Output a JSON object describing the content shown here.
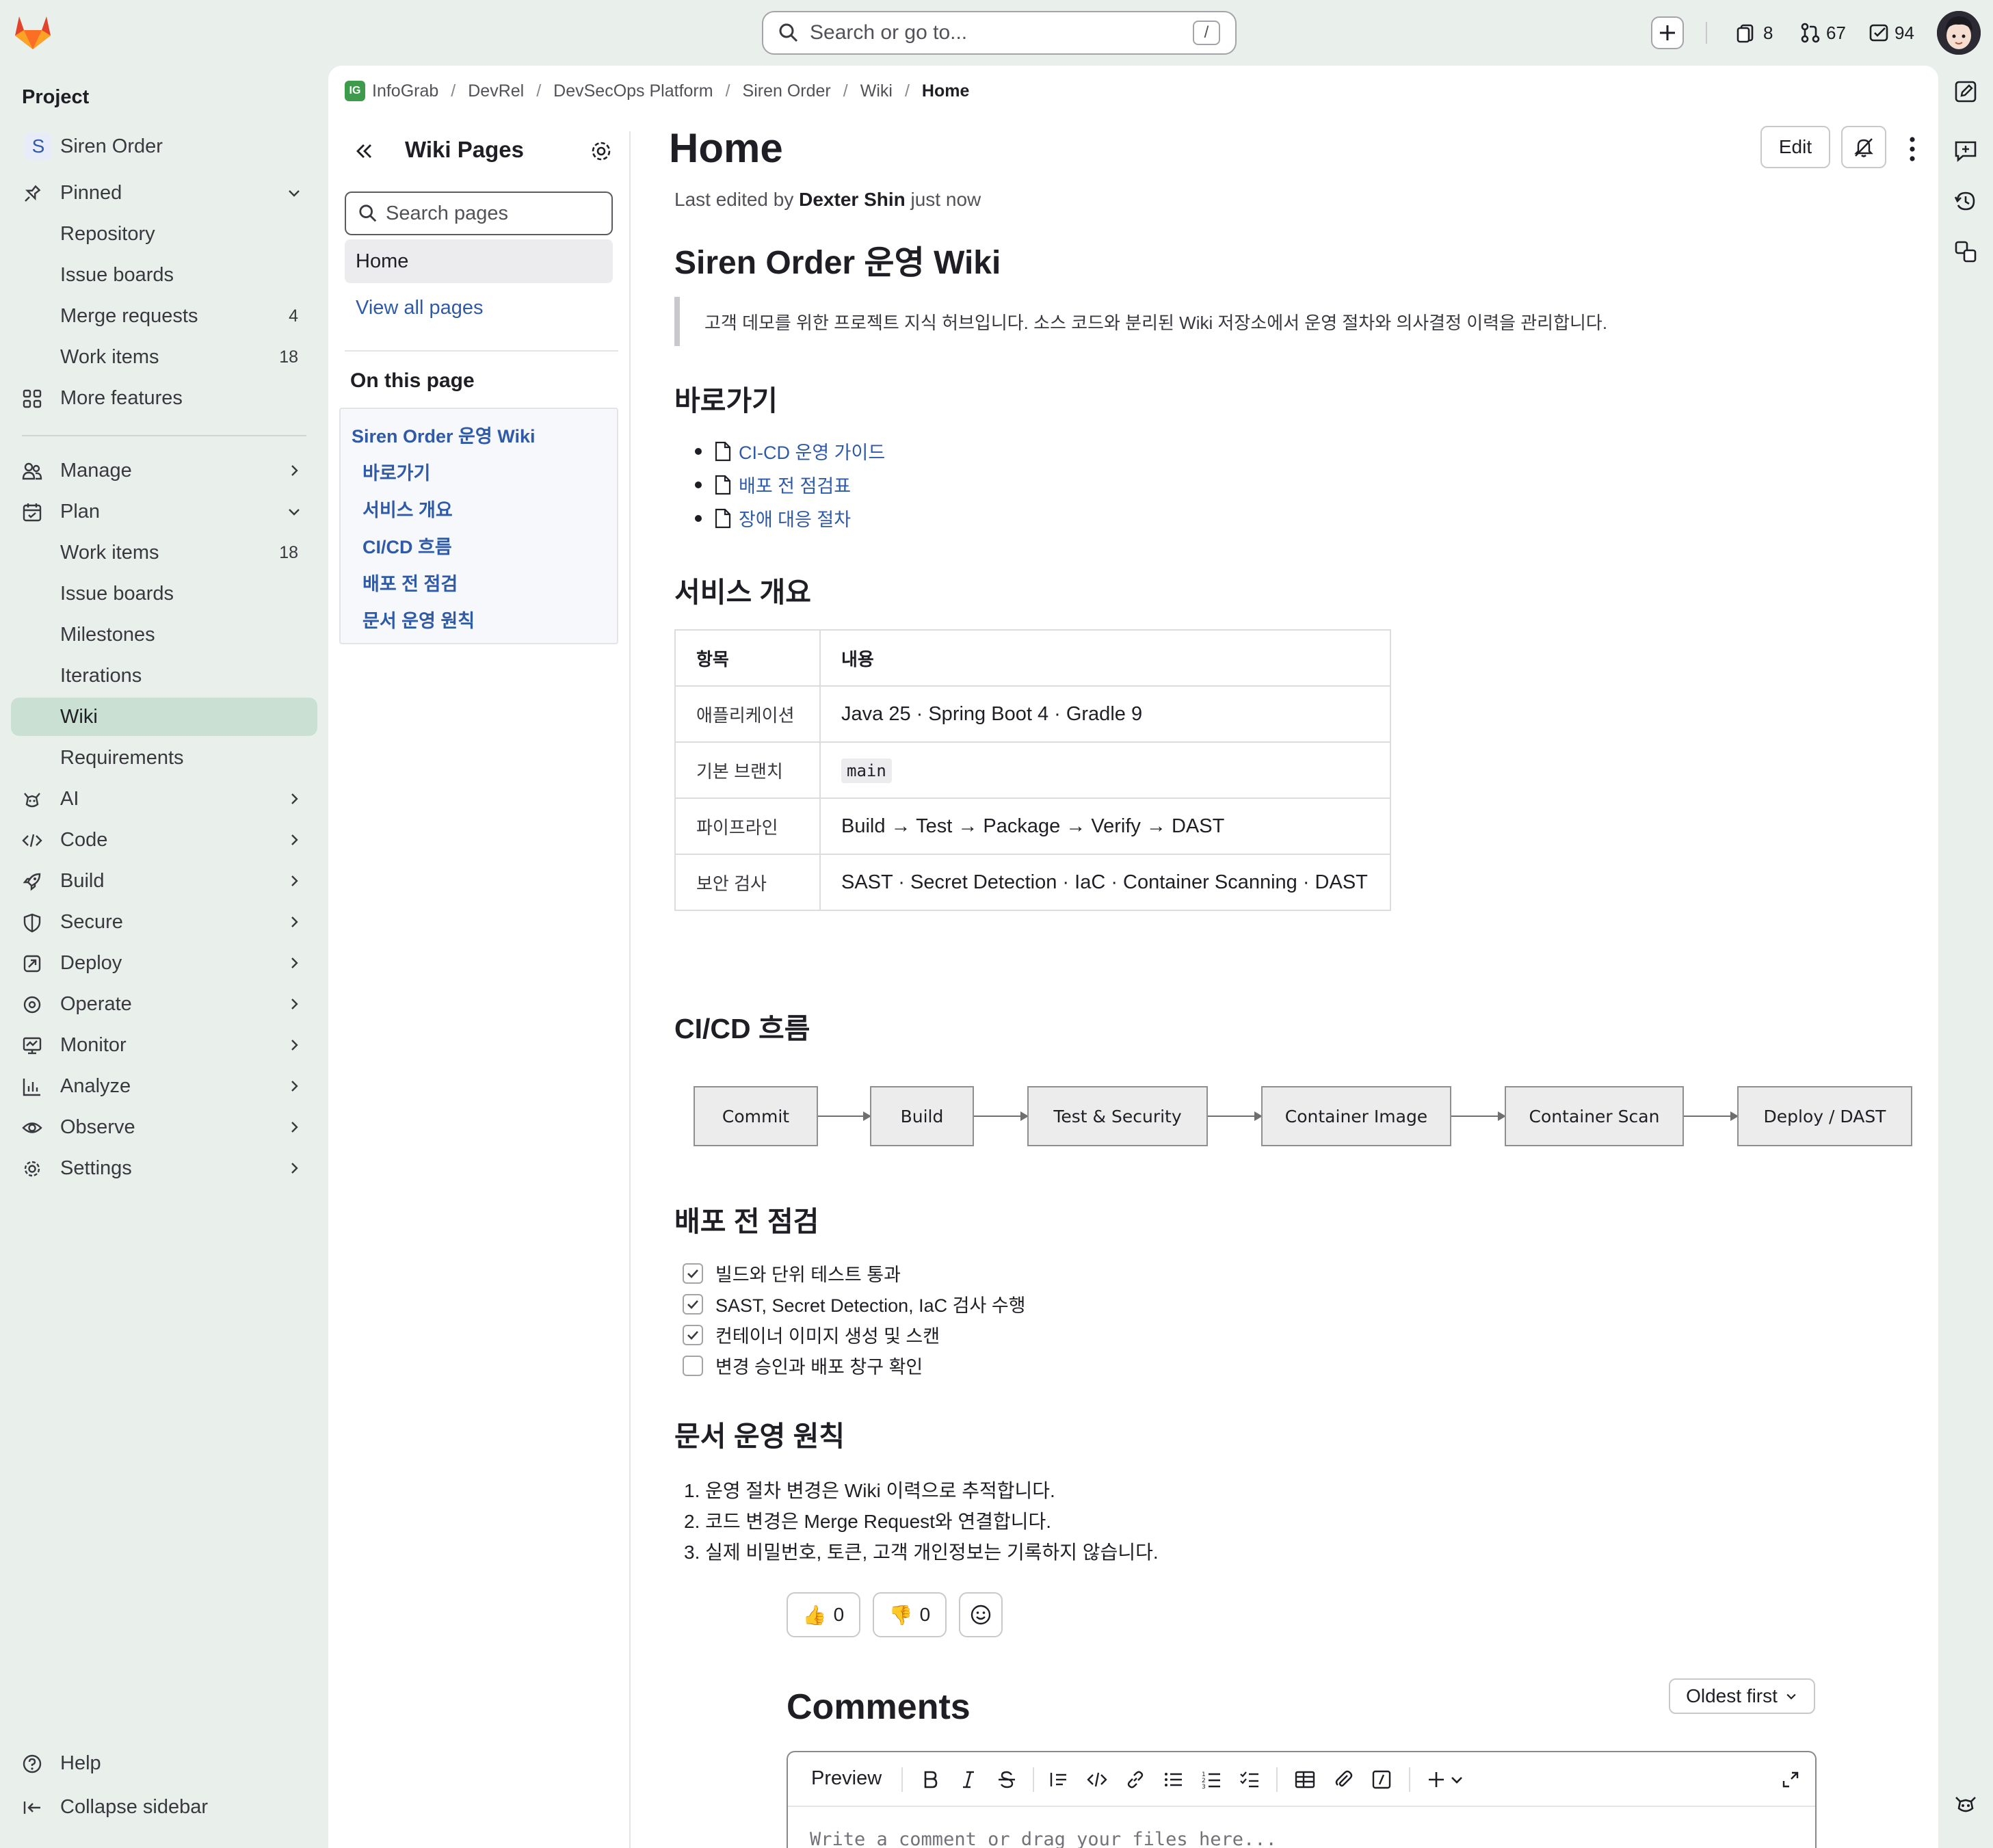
{
  "header": {
    "search_placeholder": "Search or go to...",
    "search_shortcut": "/",
    "issues_count": "8",
    "merge_requests_count": "67",
    "todos_count": "94"
  },
  "sidebar": {
    "title": "Project",
    "project_name": "Siren Order",
    "project_initial": "S",
    "pinned_label": "Pinned",
    "pinned_items": [
      {
        "label": "Repository",
        "count": ""
      },
      {
        "label": "Issue boards",
        "count": ""
      },
      {
        "label": "Merge requests",
        "count": "4"
      },
      {
        "label": "Work items",
        "count": "18"
      }
    ],
    "more_features": "More features",
    "manage": "Manage",
    "plan": "Plan",
    "plan_items": [
      {
        "label": "Work items",
        "count": "18"
      },
      {
        "label": "Issue boards",
        "count": ""
      },
      {
        "label": "Milestones",
        "count": ""
      },
      {
        "label": "Iterations",
        "count": ""
      },
      {
        "label": "Wiki",
        "count": ""
      },
      {
        "label": "Requirements",
        "count": ""
      }
    ],
    "sections": [
      "AI",
      "Code",
      "Build",
      "Secure",
      "Deploy",
      "Operate",
      "Monitor",
      "Analyze",
      "Observe",
      "Settings"
    ],
    "help": "Help",
    "collapse": "Collapse sidebar"
  },
  "breadcrumb": {
    "logo_text": "IG",
    "items": [
      "InfoGrab",
      "DevRel",
      "DevSecOps Platform",
      "Siren Order",
      "Wiki",
      "Home"
    ]
  },
  "wiki_sidebar": {
    "title": "Wiki Pages",
    "search_placeholder": "Search pages",
    "home": "Home",
    "view_all": "View all pages",
    "on_this_page": "On this page",
    "toc": [
      "Siren Order 운영 Wiki",
      "바로가기",
      "서비스 개요",
      "CI/CD 흐름",
      "배포 전 점검",
      "문서 운영 원칙"
    ]
  },
  "page": {
    "title": "Home",
    "edit_label": "Edit",
    "last_edited_prefix": "Last edited by",
    "last_edited_author": "Dexter Shin",
    "last_edited_suffix": "just now",
    "h1": "Siren Order 운영 Wiki",
    "quote": "고객 데모를 위한 프로젝트 지식 허브입니다. 소스 코드와 분리된 Wiki 저장소에서 운영 절차와 의사결정 이력을 관리합니다.",
    "shortcuts_heading": "바로가기",
    "shortcuts": [
      "CI-CD 운영 가이드",
      "배포 전 점검표",
      "장애 대응 절차"
    ],
    "overview_heading": "서비스 개요",
    "table": {
      "headers": [
        "항목",
        "내용"
      ],
      "rows": [
        [
          "애플리케이션",
          "Java 25 · Spring Boot 4 · Gradle 9"
        ],
        [
          "기본 브랜치",
          "main"
        ],
        [
          "파이프라인",
          "Build → Test → Package → Verify → DAST"
        ],
        [
          "보안 검사",
          "SAST · Secret Detection · IaC · Container Scanning · DAST"
        ]
      ]
    },
    "cicd_heading": "CI/CD 흐름",
    "flow": [
      "Commit",
      "Build",
      "Test & Security",
      "Container Image",
      "Container Scan",
      "Deploy / DAST"
    ],
    "checklist_heading": "배포 전 점검",
    "checklist": [
      {
        "label": "빌드와 단위 테스트 통과",
        "checked": true
      },
      {
        "label": "SAST, Secret Detection, IaC 검사 수행",
        "checked": true
      },
      {
        "label": "컨테이너 이미지 생성 및 스캔",
        "checked": true
      },
      {
        "label": "변경 승인과 배포 창구 확인",
        "checked": false
      }
    ],
    "principles_heading": "문서 운영 원칙",
    "principles": [
      "1. 운영 절차 변경은 Wiki 이력으로 추적합니다.",
      "2. 코드 변경은 Merge Request와 연결합니다.",
      "3. 실제 비밀번호, 토큰, 고객 개인정보는 기록하지 않습니다."
    ],
    "thumbs_up": "0",
    "thumbs_down": "0",
    "thumbs_up_emoji": "👍",
    "thumbs_down_emoji": "👎"
  },
  "comments": {
    "title": "Comments",
    "sort": "Oldest first",
    "preview": "Preview",
    "placeholder": "Write a comment or drag your files here..."
  }
}
